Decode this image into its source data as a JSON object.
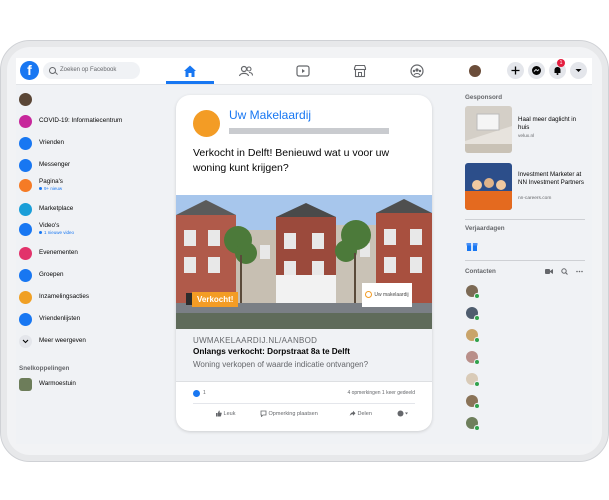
{
  "search": {
    "placeholder": "Zoeken op Facebook"
  },
  "top_nav": {
    "icons": [
      "home-icon",
      "friends-icon",
      "watch-icon",
      "marketplace-icon",
      "groups-icon"
    ],
    "notification_count": "1"
  },
  "left_menu": {
    "items": [
      {
        "label": "COVID-19: Informatiecentrum",
        "icon": "covid-info-icon",
        "color": "#c7279b"
      },
      {
        "label": "Vrienden",
        "icon": "friends-icon",
        "color": "#1877f2"
      },
      {
        "label": "Messenger",
        "icon": "messenger-icon",
        "color": "#1877f2"
      },
      {
        "label": "Pagina's",
        "sub": "9+ nieuw",
        "icon": "pages-icon",
        "color": "#f57b25"
      },
      {
        "label": "Marketplace",
        "icon": "marketplace-icon",
        "color": "#1a9ed8"
      },
      {
        "label": "Video's",
        "sub": "1 nieuwe video",
        "icon": "video-icon",
        "color": "#1877f2"
      },
      {
        "label": "Evenementen",
        "icon": "events-icon",
        "color": "#e2336b"
      },
      {
        "label": "Groepen",
        "icon": "groups-icon",
        "color": "#1877f2"
      },
      {
        "label": "Inzamelingsacties",
        "icon": "fundraiser-icon",
        "color": "#f0a025"
      },
      {
        "label": "Vriendenlijsten",
        "icon": "friend-lists-icon",
        "color": "#1877f2"
      },
      {
        "label": "Meer weergeven",
        "icon": "chevron-down-icon",
        "color": "#e4e6eb"
      }
    ],
    "shortcuts_title": "Snelkoppelingen",
    "shortcuts": [
      {
        "label": "Warmoestuin"
      }
    ]
  },
  "post": {
    "page_name": "Uw Makelaardij",
    "text": "Verkocht in Delft! Benieuwd wat u voor uw woning kunt krijgen?",
    "photo_label": "Verkocht!",
    "photo_logo": "Uw makelaardij",
    "link_domain": "UWMAKELAARDIJ.NL/AANBOD",
    "link_title": "Onlangs verkocht: Dorpstraat 8a te Delft",
    "link_desc": "Woning verkopen of waarde indicatie ontvangen?",
    "likes": "1",
    "comments_shares": "4 opmerkingen  1 keer gedeeld",
    "actions": {
      "like": "Leuk",
      "comment": "Opmerking plaatsen",
      "share": "Delen"
    }
  },
  "right": {
    "sponsored_title": "Gesponsord",
    "ads": [
      {
        "title": "Haal meer daglicht in huis",
        "url": "velux.nl"
      },
      {
        "title": "Investment Marketer at NN Investment Partners",
        "url": "nn-careers.com"
      }
    ],
    "birthdays_title": "Verjaardagen",
    "contacts_title": "Contacten"
  },
  "colors": {
    "accent": "#1877f2",
    "brand_orange": "#f39c25",
    "online": "#31a24c"
  }
}
